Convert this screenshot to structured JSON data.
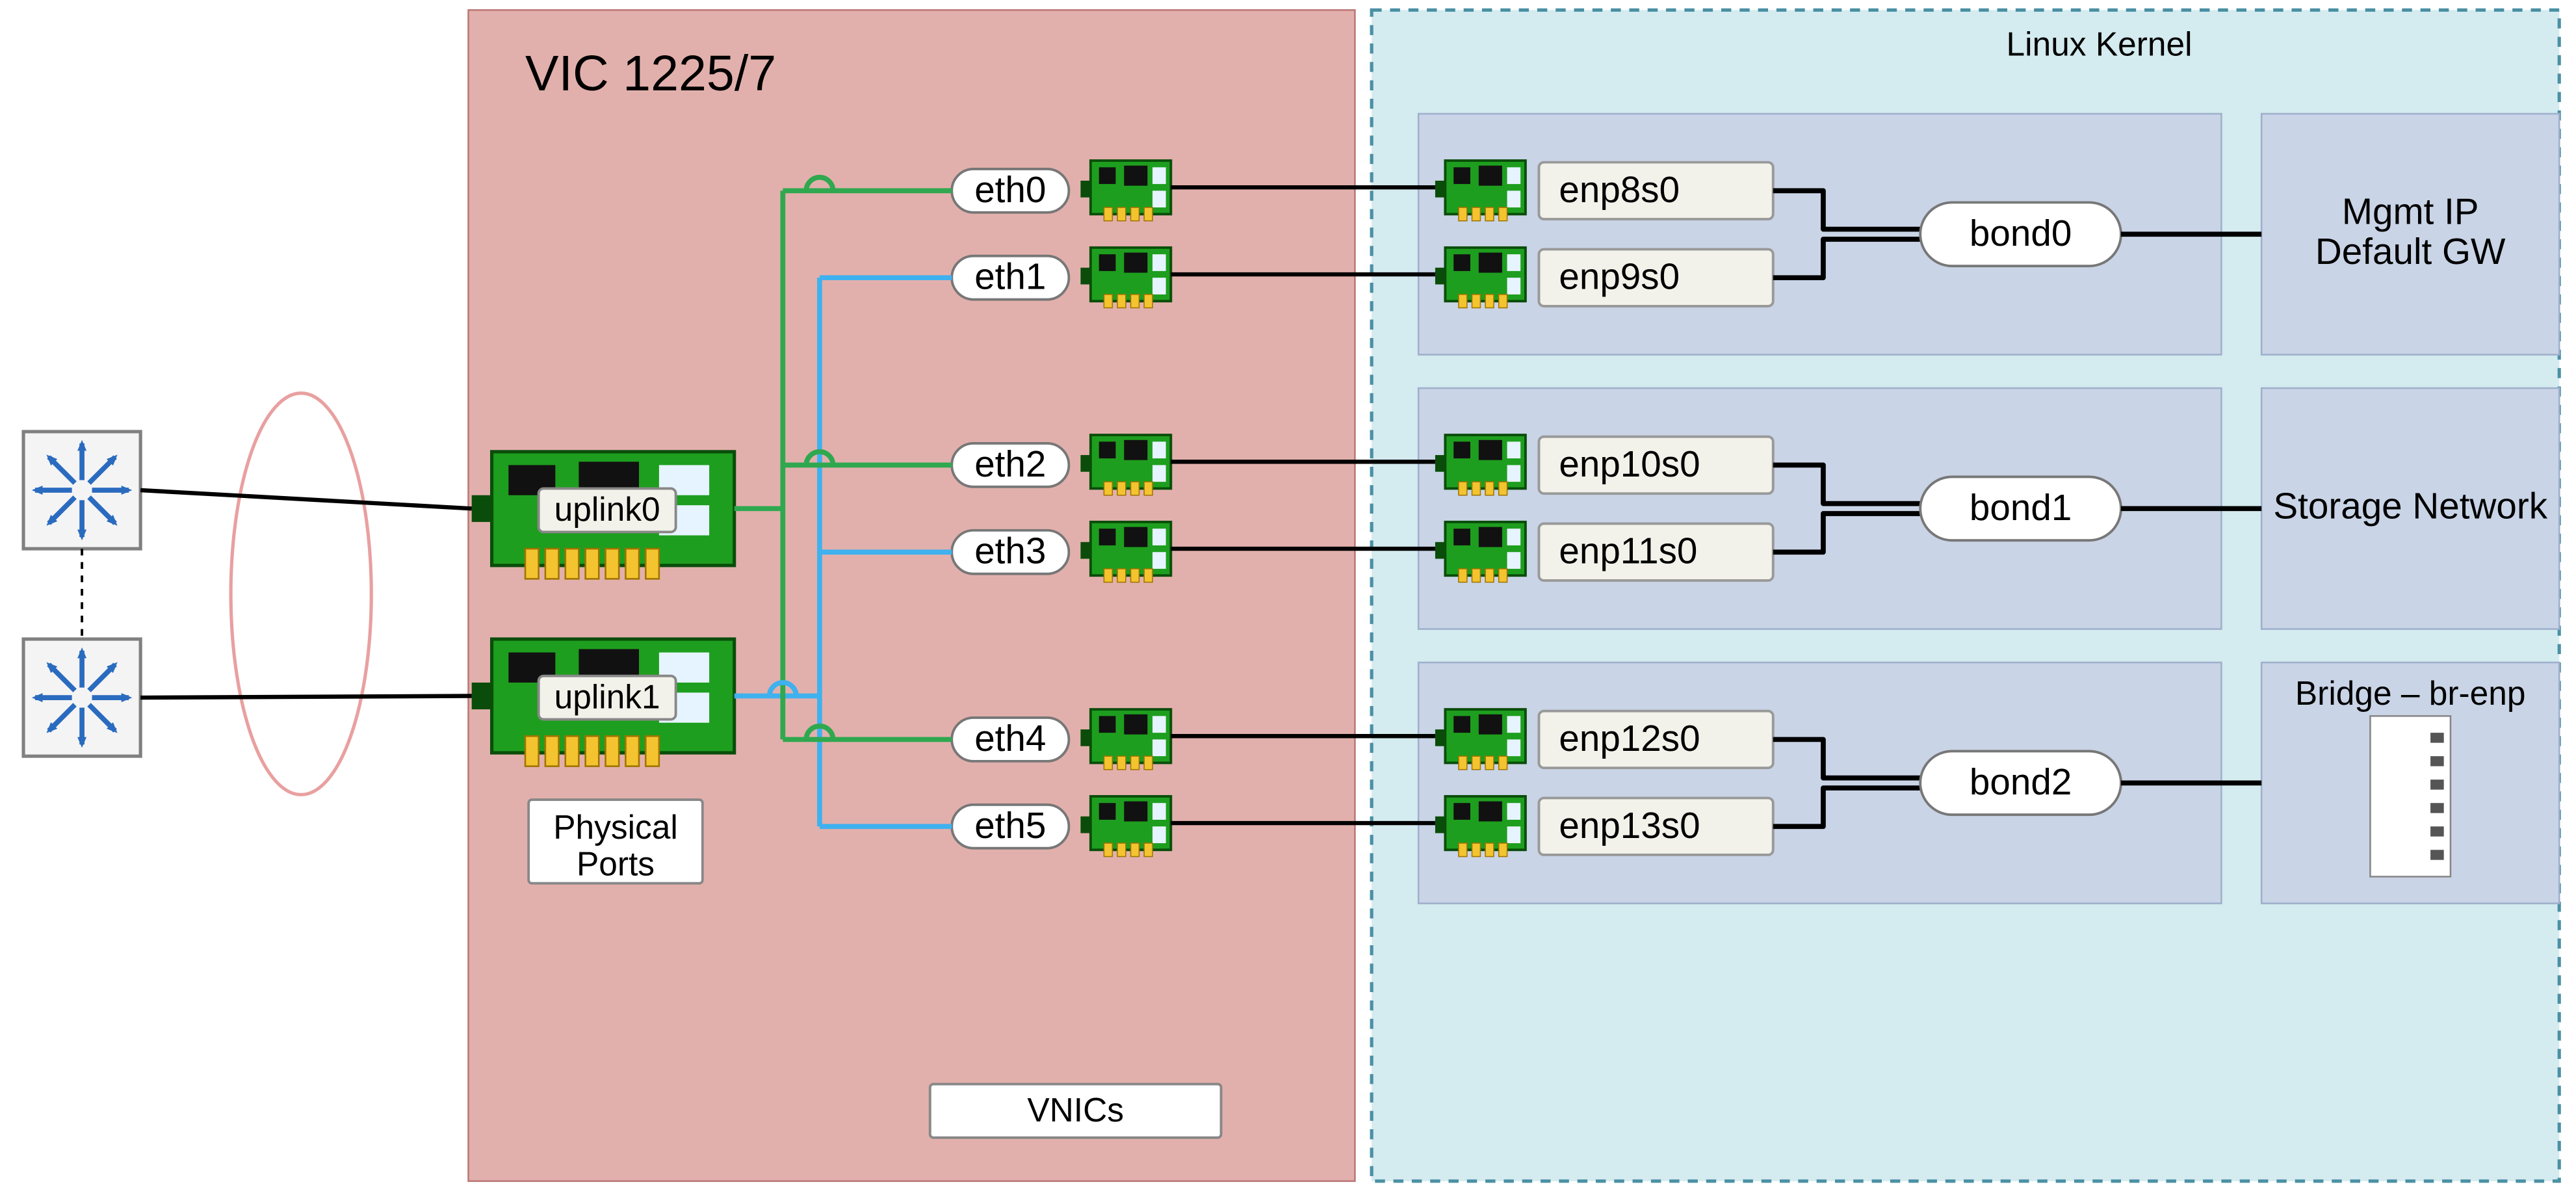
{
  "vic": {
    "title": "VIC 1225/7",
    "uplinks": [
      "uplink0",
      "uplink1"
    ],
    "physical_ports_label": "Physical\nPorts",
    "vnics_label": "VNICs",
    "vnics": [
      "eth0",
      "eth1",
      "eth2",
      "eth3",
      "eth4",
      "eth5"
    ]
  },
  "kernel": {
    "title": "Linux Kernel",
    "groups": [
      {
        "ifaces": [
          "enp8s0",
          "enp9s0"
        ],
        "bond": "bond0",
        "box_title": null,
        "box_lines": [
          "Mgmt IP",
          "Default GW"
        ],
        "box_has_bridge_icon": false
      },
      {
        "ifaces": [
          "enp10s0",
          "enp11s0"
        ],
        "bond": "bond1",
        "box_title": null,
        "box_lines": [
          "Storage Network"
        ],
        "box_has_bridge_icon": false
      },
      {
        "ifaces": [
          "enp12s0",
          "enp13s0"
        ],
        "bond": "bond2",
        "box_title": "Bridge – br-enp",
        "box_lines": [],
        "box_has_bridge_icon": true
      }
    ]
  },
  "colors": {
    "vic_bg": "#e2b0ac",
    "kernel_bg": "#d4ebef",
    "group_bg": "#c9d4e6",
    "outbox_bg": "#c9d4e6",
    "green": "#2fa84f",
    "blue": "#3fb1ef",
    "black": "#000000",
    "ellipse": "#e9a0a0",
    "nic_green": "#1e9e1e",
    "nic_dark": "#0a4d0a",
    "nic_gold": "#f4c430",
    "switch_frame": "#808080",
    "switch_arrow": "#2a6bbf"
  }
}
